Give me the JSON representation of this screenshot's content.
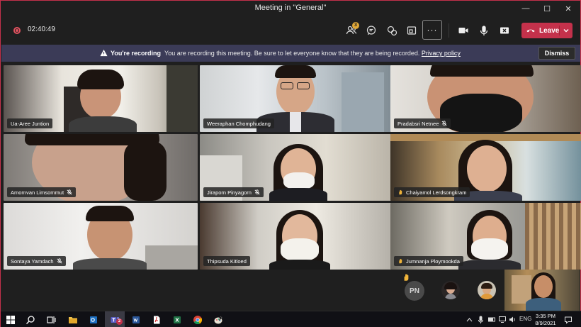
{
  "window": {
    "title": "Meeting in \"General\"",
    "minimize_glyph": "—",
    "maximize_glyph": "☐",
    "close_glyph": "✕"
  },
  "toolbar": {
    "recording_time": "02:40:49",
    "participants_count": "3",
    "more_label": "···",
    "leave_label": "Leave",
    "icons": [
      "people-icon",
      "chat-icon",
      "reactions-icon",
      "share-tray-icon",
      "more-actions-icon",
      "camera-icon",
      "mic-icon",
      "share-screen-icon",
      "hang-up-icon"
    ]
  },
  "banner": {
    "heading": "You're recording",
    "message": "You are recording this meeting. Be sure to let everyone know that they are being recorded.",
    "link": "Privacy policy",
    "dismiss_label": "Dismiss"
  },
  "participants": [
    {
      "name": "Ua-Aree Juntion",
      "muted": false,
      "hand_raised": false
    },
    {
      "name": "Weeraphan Chomphudang",
      "muted": false,
      "hand_raised": false
    },
    {
      "name": "Pradabsri Netnee",
      "muted": true,
      "hand_raised": false
    },
    {
      "name": "Amornvan Limsommut",
      "muted": true,
      "hand_raised": false
    },
    {
      "name": "Jiraporn Pinyagorn",
      "muted": true,
      "hand_raised": false
    },
    {
      "name": "Chaiyamol Lerdsongkram",
      "muted": false,
      "hand_raised": true
    },
    {
      "name": "Sontaya Yamdach",
      "muted": true,
      "hand_raised": false
    },
    {
      "name": "Thipsuda Kitloed",
      "muted": false,
      "hand_raised": false
    },
    {
      "name": "Jumnanja Ploymookda",
      "muted": false,
      "hand_raised": true
    }
  ],
  "strip": {
    "initials": "PN"
  },
  "taskbar": {
    "notification_badge": "2",
    "language": "ENG",
    "time": "3:35 PM",
    "date": "8/9/2021"
  },
  "colors": {
    "accent_red": "#c4314b",
    "banner_bg": "#3b3b57",
    "window_bg": "#1f1f1f"
  }
}
